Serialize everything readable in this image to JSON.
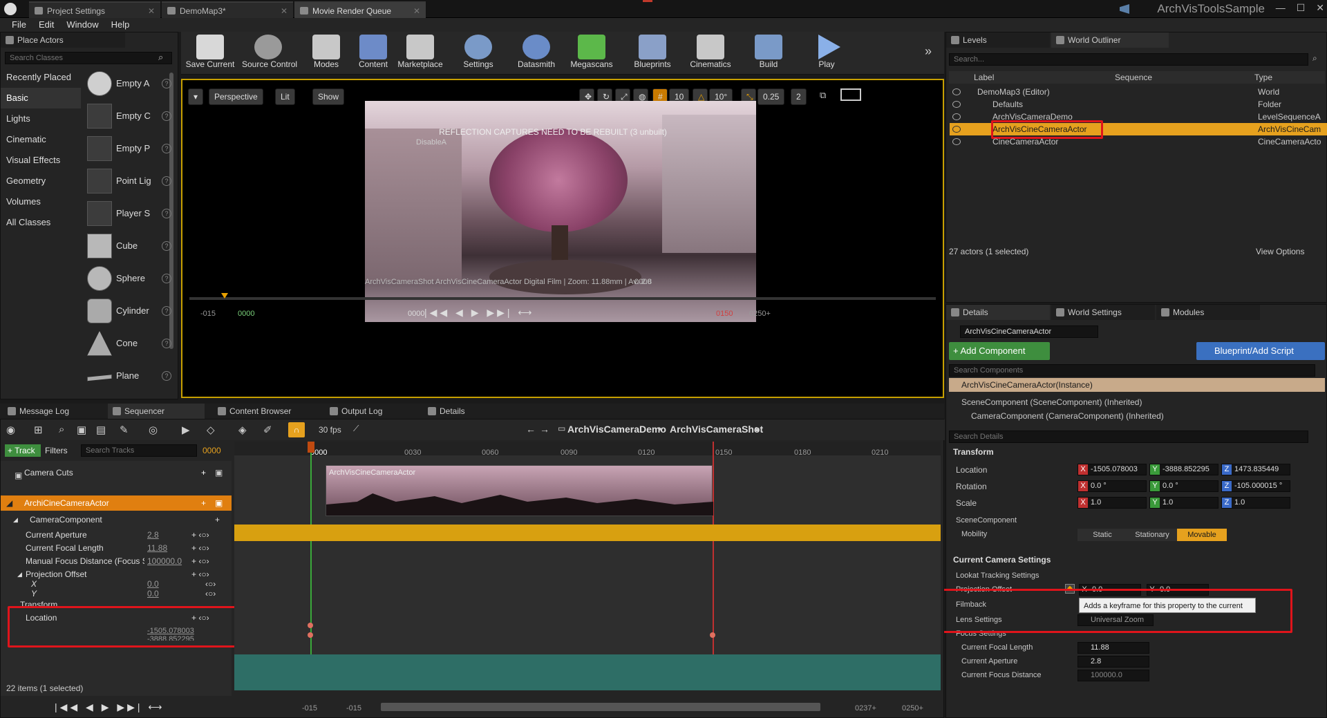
{
  "title_tabs": [
    "Project Settings",
    "DemoMap3*",
    "Movie Render Queue"
  ],
  "project_name": "ArchVisToolsSample",
  "menu": [
    "File",
    "Edit",
    "Window",
    "Help"
  ],
  "place_actors": {
    "tab": "Place Actors",
    "search_placeholder": "Search Classes",
    "categories": [
      "Recently Placed",
      "Basic",
      "Lights",
      "Cinematic",
      "Visual Effects",
      "Geometry",
      "Volumes",
      "All Classes"
    ],
    "actors": [
      "Empty A",
      "Empty C",
      "Empty P",
      "Point Lig",
      "Player S",
      "Cube",
      "Sphere",
      "Cylinder",
      "Cone",
      "Plane"
    ]
  },
  "toolbar": [
    "Save Current",
    "Source Control",
    "Modes",
    "Content",
    "Marketplace",
    "Settings",
    "Datasmith",
    "Megascans",
    "Blueprints",
    "Cinematics",
    "Build",
    "Play"
  ],
  "viewport": {
    "perspective": "Perspective",
    "lit": "Lit",
    "show": "Show",
    "grid": "10",
    "angle": "10°",
    "scale": "0.25",
    "cam": "2",
    "warning": "REFLECTION CAPTURES NEED TO BE REBUILT (3 unbuilt)",
    "warning2": "DisableA",
    "caption": "ArchVisCameraShot  ArchVisCineCameraActor  Digital Film | Zoom: 11.88mm | Av: 2.8",
    "frame": "0000",
    "tl_start": "-015",
    "tl_cur": "0000",
    "tl_cur2": "0000",
    "tl_end": "0150",
    "tl_end2": "0250+"
  },
  "outliner": {
    "tabs": [
      "Levels",
      "World Outliner"
    ],
    "search_placeholder": "Search...",
    "cols": [
      "Label",
      "Sequence",
      "Type"
    ],
    "rows": [
      {
        "label": "DemoMap3 (Editor)",
        "type": "World"
      },
      {
        "label": "Defaults",
        "type": "Folder"
      },
      {
        "label": "ArchVisCameraDemo",
        "type": "LevelSequenceA"
      },
      {
        "label": "ArchVisCineCameraActor",
        "type": "ArchVisCineCam"
      },
      {
        "label": "CineCameraActor",
        "type": "CineCameraActo"
      }
    ],
    "count": "27 actors (1 selected)",
    "view_options": "View Options"
  },
  "details": {
    "tabs": [
      "Details",
      "World Settings",
      "Modules"
    ],
    "name": "ArchVisCineCameraActor",
    "add_component": "+ Add Component",
    "blueprint": "Blueprint/Add Script",
    "search_components": "Search Components",
    "instance": "ArchVisCineCameraActor(Instance)",
    "comp1": "SceneComponent (SceneComponent) (Inherited)",
    "comp2": "CameraComponent (CameraComponent) (Inherited)",
    "search_details": "Search Details",
    "transform": "Transform",
    "location": "Location",
    "rotation": "Rotation",
    "scale": "Scale",
    "loc": [
      "-1505.078003",
      "-3888.852295",
      "1473.835449"
    ],
    "rot": [
      "0.0 °",
      "0.0 °",
      "-105.000015 °"
    ],
    "scl": [
      "1.0",
      "1.0",
      "1.0"
    ],
    "scene_component": "SceneComponent",
    "mobility": "Mobility",
    "mob": [
      "Static",
      "Stationary",
      "Movable"
    ],
    "current_camera": "Current Camera Settings",
    "lookat": "Lookat Tracking Settings",
    "proj_offset": "Projection Offset",
    "px": "0.0",
    "py": "0.0",
    "filmback": "Filmback",
    "tooltip": "Adds a keyframe for this property to the current animation",
    "lens": "Lens Settings",
    "lens_val": "Universal Zoom",
    "focus": "Focus Settings",
    "focal": "Current Focal Length",
    "focal_v": "11.88",
    "aperture": "Current Aperture",
    "aperture_v": "2.8",
    "focus_dist": "Current Focus Distance",
    "focus_dist_v": "100000.0"
  },
  "bottom_tabs": [
    "Message Log",
    "Sequencer",
    "Content Browser",
    "Output Log",
    "Details"
  ],
  "sequencer": {
    "fps": "30 fps",
    "breadcrumb1": "ArchVisCameraDemo",
    "breadcrumb2": "ArchVisCameraShot",
    "track": "+ Track",
    "filters": "Filters",
    "search_placeholder": "Search Tracks",
    "frame": "0000",
    "camera_cuts": "Camera Cuts",
    "actor": "ArchiCineCameraActor",
    "camera_component": "CameraComponent",
    "props": [
      {
        "n": "Current Aperture",
        "v": "2.8"
      },
      {
        "n": "Current Focal Length",
        "v": "11.88"
      },
      {
        "n": "Manual Focus Distance (Focus Setting",
        "v": "100000.0"
      }
    ],
    "proj": "Projection Offset",
    "x": "X",
    "y": "Y",
    "xv": "0.0",
    "yv": "0.0",
    "transform": "Transform",
    "location": "Location",
    "loc_v1": "-1505.078003",
    "loc_v2": "-3888.852295",
    "items": "22 items (1 selected)",
    "ruler": [
      "0000",
      "0030",
      "0060",
      "0090",
      "0120",
      "0150",
      "0180",
      "0210"
    ],
    "clip": "ArchVisCineCameraActor",
    "bt": [
      "-015",
      "-015",
      "0237+",
      "0250+"
    ]
  }
}
